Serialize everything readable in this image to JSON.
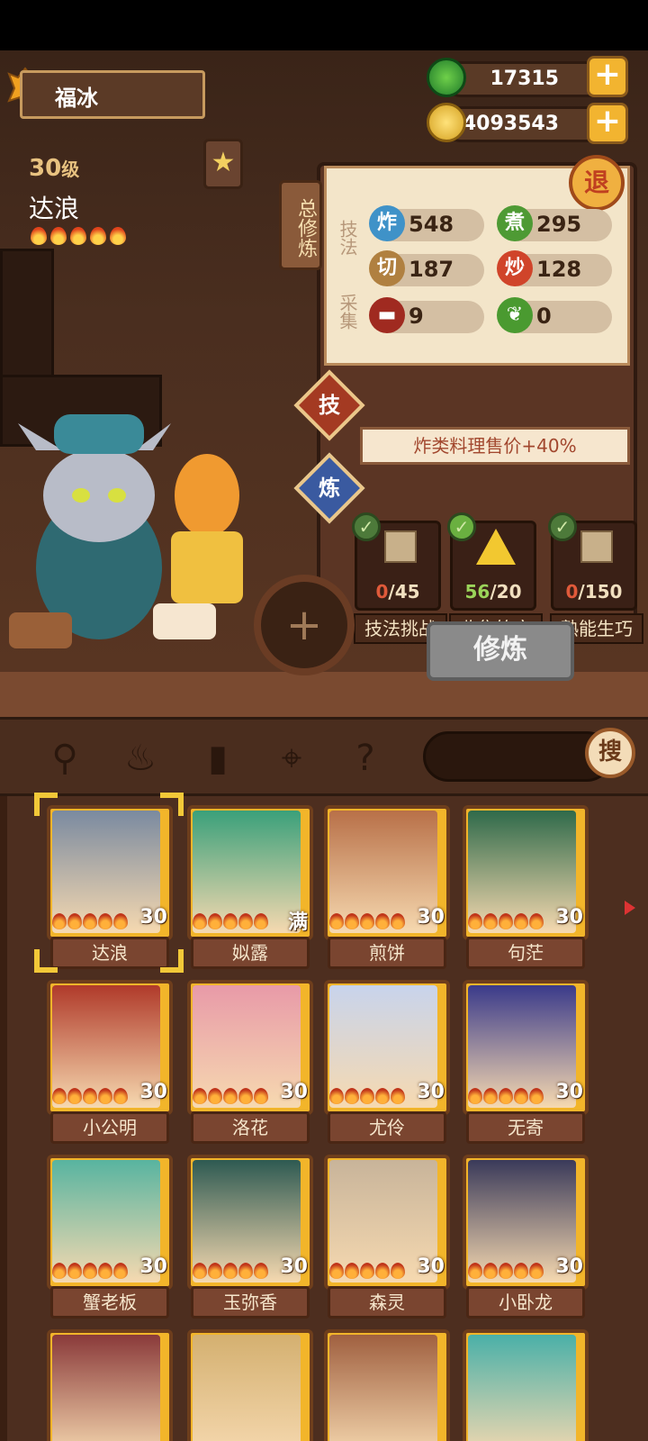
{
  "player": {
    "name": "福冰"
  },
  "currency": {
    "jade": "17315",
    "coins": "74093543",
    "plus": "+"
  },
  "character": {
    "level": "30",
    "level_unit": "级",
    "name": "达浪",
    "flames": 5
  },
  "panel": {
    "tab_label": "总修炼",
    "exit_label": "退",
    "section_skills": "技法",
    "section_gather": "采集",
    "skills": [
      {
        "icon": "炸",
        "value": "548",
        "color": "#3f92c8"
      },
      {
        "icon": "煮",
        "value": "295",
        "color": "#4e9a34"
      },
      {
        "icon": "切",
        "value": "187",
        "color": "#b08040"
      },
      {
        "icon": "炒",
        "value": "128",
        "color": "#d0442a"
      }
    ],
    "gather": [
      {
        "icon": "meat-icon",
        "value": "9"
      },
      {
        "icon": "vegetable-icon",
        "value": "0"
      }
    ],
    "tab_skill": "技",
    "tab_train": "炼",
    "bonus_text": "炸类料理售价+40%",
    "tasks": [
      {
        "label": "技法挑战",
        "progress": "0/45",
        "done": "0",
        "total": "/45",
        "done_color": "#e05a3a"
      },
      {
        "label": "收集符文",
        "progress": "56/20",
        "done": "56",
        "total": "/20",
        "done_color": "#9bd45a"
      },
      {
        "label": "熟能生巧",
        "progress": "0/150",
        "done": "0",
        "total": "/150",
        "done_color": "#e05a3a"
      }
    ],
    "train_button": "修炼"
  },
  "toolbar": {
    "search_button": "搜",
    "icons": [
      "spatula-icon",
      "ladle-icon",
      "jar-icon",
      "location-pin-icon",
      "map-question-icon"
    ]
  },
  "cards": [
    {
      "name": "达浪",
      "level": "30",
      "color": "#7a8aa0",
      "selected": true
    },
    {
      "name": "姒露",
      "level": "满",
      "color": "#3aa07a"
    },
    {
      "name": "煎饼",
      "level": "30",
      "color": "#b87048"
    },
    {
      "name": "句茫",
      "level": "30",
      "color": "#2f6a4a"
    },
    {
      "name": "小公明",
      "level": "30",
      "color": "#b03a2a"
    },
    {
      "name": "洛花",
      "level": "30",
      "color": "#e89aa8"
    },
    {
      "name": "尤伶",
      "level": "30",
      "color": "#c8d4ec"
    },
    {
      "name": "无寄",
      "level": "30",
      "color": "#3a3a8a"
    },
    {
      "name": "蟹老板",
      "level": "30",
      "color": "#58b4a0"
    },
    {
      "name": "玉弥香",
      "level": "30",
      "color": "#2e5a52"
    },
    {
      "name": "森灵",
      "level": "30",
      "color": "#c8b49a"
    },
    {
      "name": "小卧龙",
      "level": "30",
      "color": "#3a3a5a"
    },
    {
      "name": "",
      "level": "",
      "color": "#8a3a3a"
    },
    {
      "name": "",
      "level": "",
      "color": "#d4b070"
    },
    {
      "name": "",
      "level": "",
      "color": "#a06040"
    },
    {
      "name": "",
      "level": "",
      "color": "#4ab0a8"
    }
  ]
}
